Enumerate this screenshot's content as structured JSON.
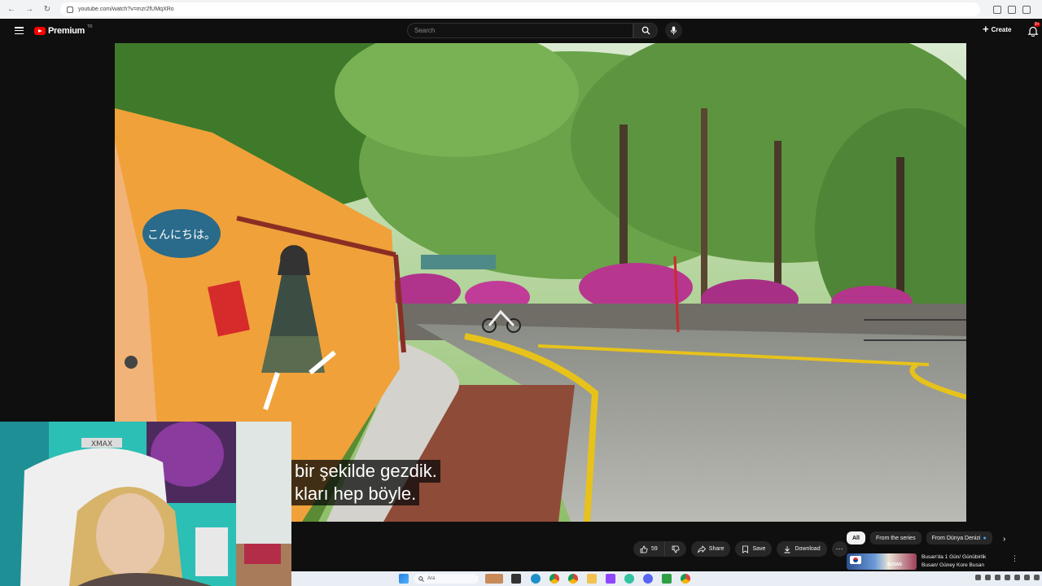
{
  "browser": {
    "url": "youtube.com/watch?v=mzr2fUMqXRo"
  },
  "header": {
    "brand": "Premium",
    "region": "TR",
    "search_placeholder": "Search",
    "create_label": "Create",
    "notification_badge": "9+"
  },
  "video": {
    "caption_line_1": "bir şekilde gezdik.",
    "caption_line_2": "kları hep böyle.",
    "mural_bubble": "こんにちは。"
  },
  "actions": {
    "like_count": "59",
    "share_label": "Share",
    "save_label": "Save",
    "download_label": "Download"
  },
  "chips": [
    {
      "label": "All"
    },
    {
      "label": "From the series"
    },
    {
      "label": "From Dünya Denizi"
    }
  ],
  "recommendation": {
    "thumb_text": "BUSAN",
    "title_line_1": "Busan'da 1 Gün/ Günübirlik",
    "title_line_2": "Busan/ Güney Kore Busan"
  },
  "taskbar": {
    "search_placeholder": "Ara"
  },
  "colors": {
    "yt_red": "#ff0000",
    "dark_bg": "#0f0f0f",
    "pill_bg": "#272727"
  }
}
